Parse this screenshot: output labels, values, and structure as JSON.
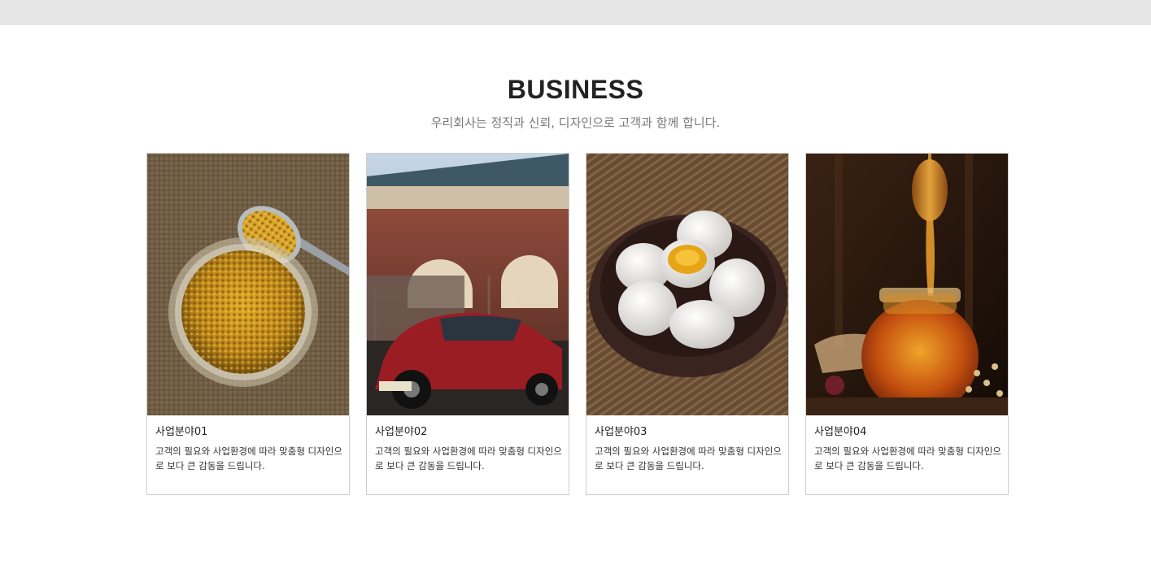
{
  "section": {
    "title": "BUSINESS",
    "subtitle": "우리회사는 정직과 신뢰, 디자인으로 고객과 함께 합니다."
  },
  "cards": [
    {
      "title": "사업분야01",
      "description": "고객의 필요와 사업환경에 따라 맞춤형 디자인으로 보다 큰 감동을 드립니다.",
      "image": "bee-pollen-jar-photo"
    },
    {
      "title": "사업분야02",
      "description": "고객의 필요와 사업환경에 따라 맞춤형 디자인으로 보다 큰 감동을 드립니다.",
      "image": "red-vintage-car-photo"
    },
    {
      "title": "사업분야03",
      "description": "고객의 필요와 사업환경에 따라 맞춤형 디자인으로 보다 큰 감동을 드립니다.",
      "image": "eggs-in-bowl-photo"
    },
    {
      "title": "사업분야04",
      "description": "고객의 필요와 사업환경에 따라 맞춤형 디자인으로 보다 큰 감동을 드립니다.",
      "image": "honey-jar-dipper-photo"
    }
  ]
}
